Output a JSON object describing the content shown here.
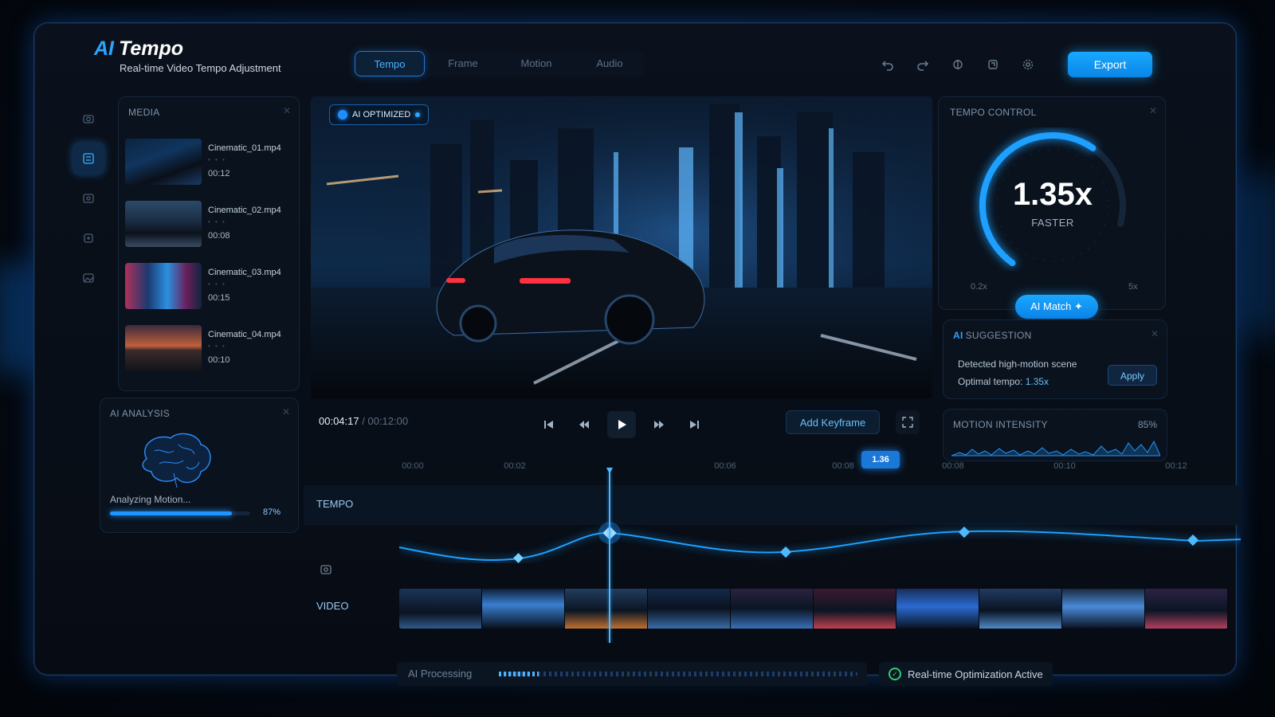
{
  "app": {
    "name_ai": "AI",
    "name": "Tempo",
    "subtitle": "Real-time Video Tempo Adjustment"
  },
  "tabs": [
    {
      "label": "Tempo",
      "active": true
    },
    {
      "label": "Frame",
      "active": false
    },
    {
      "label": "Motion",
      "active": false
    },
    {
      "label": "Audio",
      "active": false
    }
  ],
  "toolbar": {
    "icons": [
      "undo-icon",
      "redo-icon",
      "compare-icon",
      "crop-icon",
      "settings-icon"
    ],
    "export_label": "Export"
  },
  "sidebar": {
    "icons": [
      "camera-icon",
      "media-icon",
      "effects-icon",
      "transform-icon",
      "gallery-icon"
    ],
    "active_index": 1
  },
  "media": {
    "title": "MEDIA",
    "items": [
      {
        "name": "Cinematic_01.mp4",
        "meta": "• • •",
        "duration": "00:12"
      },
      {
        "name": "Cinematic_02.mp4",
        "meta": "• • •",
        "duration": "00:08"
      },
      {
        "name": "Cinematic_03.mp4",
        "meta": "• • •",
        "duration": "00:15"
      },
      {
        "name": "Cinematic_04.mp4",
        "meta": "• • •",
        "duration": "00:10"
      }
    ]
  },
  "analysis": {
    "title": "AI ANALYSIS",
    "status": "Analyzing Motion...",
    "progress_label": "87%",
    "progress": 0.87
  },
  "viewer": {
    "badge": "AI OPTIMIZED"
  },
  "playback": {
    "current": "00:04:17",
    "total": "/ 00:12:00",
    "add_keyframe": "Add Keyframe"
  },
  "tempo_control": {
    "title": "TEMPO CONTROL",
    "value": "1.35x",
    "label": "FASTER",
    "min": "0.2x",
    "max": "5x",
    "level": 0.72,
    "ai_match": "AI Match ✦"
  },
  "suggestion": {
    "title_ai": "AI",
    "title": "SUGGESTION",
    "line1": "Detected high-motion scene",
    "line2_prefix": "Optimal tempo: ",
    "line2_value": "1.35x",
    "apply": "Apply"
  },
  "motion_intensity": {
    "title": "MOTION INTENSITY",
    "value": "85%"
  },
  "timeline": {
    "ticks": [
      "00:00",
      "00:02",
      "00:06",
      "00:08",
      "00:08",
      "00:10",
      "00:12"
    ],
    "playhead_label": "1.36",
    "tracks": {
      "tempo": "TEMPO",
      "video": "VIDEO"
    }
  },
  "status": {
    "processing": "AI Processing",
    "realtime": "Real-time Optimization Active"
  },
  "colors": {
    "accent": "#1aa8ff",
    "success": "#2ecc71",
    "bg": "#070c14"
  }
}
